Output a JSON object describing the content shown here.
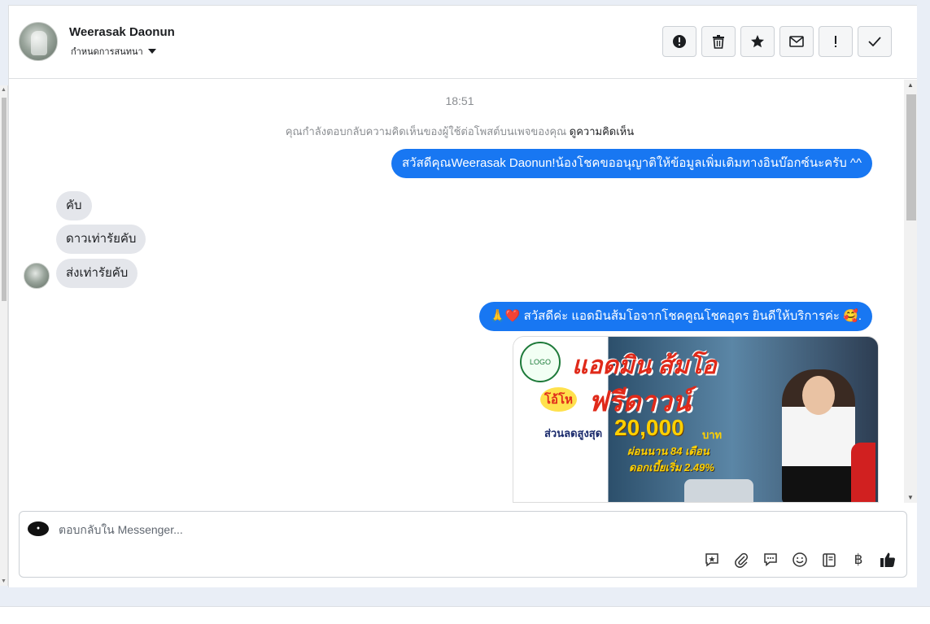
{
  "header": {
    "contact_name": "Weerasak Daonun",
    "assign_label": "กำหนดการสนทนา",
    "actions": [
      {
        "name": "spam-button",
        "icon": "alert-circle-icon"
      },
      {
        "name": "delete-button",
        "icon": "trash-icon"
      },
      {
        "name": "follow-up-button",
        "icon": "star-icon"
      },
      {
        "name": "mark-unread-button",
        "icon": "envelope-icon"
      },
      {
        "name": "priority-button",
        "icon": "exclamation-icon"
      },
      {
        "name": "done-button",
        "icon": "checkmark-icon"
      }
    ]
  },
  "thread": {
    "timestamp": "18:51",
    "notice_text": "คุณกำลังตอบกลับความคิดเห็นของผู้ใช้ต่อโพสต์บนเพจของคุณ",
    "notice_link": "ดูความคิดเห็น",
    "messages": [
      {
        "direction": "out",
        "text": "สวัสดีคุณWeerasak Daonun!น้องโชคขออนุญาติให้ข้อมูลเพิ่มเติมทางอินบ๊อกซ์นะครับ ^^"
      },
      {
        "direction": "in",
        "text": "คับ"
      },
      {
        "direction": "in",
        "text": "ดาวเท่ารัยคับ"
      },
      {
        "direction": "in",
        "text": "ส่งเท่ารัยคับ"
      },
      {
        "direction": "out",
        "text": "🙏❤️ สวัสดีค่ะ แอดมินส้มโอจากโชคคูณโชคอุดร ยินดีให้บริการค่ะ 🥰."
      }
    ],
    "promo": {
      "headline": "แอดมิน ส้มโอ",
      "badge": "โอ้โห",
      "offer": "ฟรีดาวน์",
      "discount_label": "ส่วนลดสูงสุด",
      "discount_value": "20,000",
      "currency": "บาท",
      "installment": "ผ่อนนาน 84 เดือน",
      "interest": "ดอกเบี้ยเริ่ม 2.49%"
    }
  },
  "composer": {
    "placeholder": "ตอบกลับใน Messenger...",
    "tools": [
      "saved-reply-icon",
      "attachment-icon",
      "comment-icon",
      "emoji-icon",
      "catalog-icon",
      "baht-icon",
      "like-icon"
    ],
    "baht_symbol": "฿"
  }
}
